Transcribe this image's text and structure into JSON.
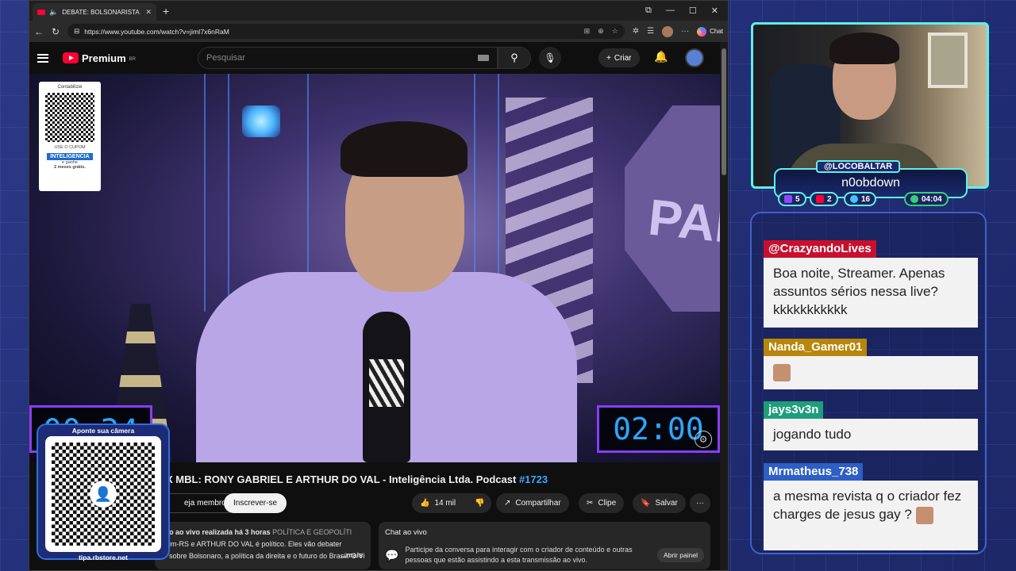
{
  "browser": {
    "tab_title": "DEBATE: BOLSONARISTA X M",
    "url": "https://www.youtube.com/watch?v=jimI7x6nRaM",
    "chat_label": "Chat"
  },
  "youtube": {
    "brand": "Premium",
    "region": "BR",
    "search_placeholder": "Pesquisar",
    "create_label": "Criar"
  },
  "video": {
    "qr_left_top": "Contabilizei",
    "qr_left_mid": "USE O CUPOM",
    "qr_left_tag": "INTELIGENCIA",
    "qr_left_line1": "e ganhe",
    "qr_left_line2": "2 meses grátis.",
    "stop_sign": "PAR",
    "timer_left": "00:34",
    "timer_right": "02:00"
  },
  "watch": {
    "title": "X MBL: RONY GABRIEL E ARTHUR DO VAL - Inteligência Ltda. Podcast",
    "title_hash": "#1723",
    "member_label": "eja membro",
    "subscribe_label": "Inscrever-se",
    "likes": "14 mil",
    "share_label": "Compartilhar",
    "clip_label": "Clipe",
    "save_label": "Salvar",
    "desc_line1": "o ao vivo realizada há 3 horas",
    "desc_category": "POLÍTICA E GEOPOLÍTI",
    "desc_line2": "im-RS e ARTHUR DO VAL é político. Eles vão debater",
    "desc_line3": "sobre Bolsonaro, a política da direita e o futuro do Brasil. O Vilela se preocupa muito",
    "desc_more": "...mais",
    "chat_title": "Chat ao vivo",
    "chat_text": "Participe da conversa para interagir com o criador de conteúdo e outras pessoas que estão assistindo a esta transmissão ao vivo.",
    "chat_open": "Abrir painel"
  },
  "qr_overlay": {
    "caption": "Aponte sua câmera",
    "footer": "tipa.rbstore.net"
  },
  "streamer": {
    "handle": "@LOCOBALTAR",
    "subtitle": "n0obdown",
    "badges": [
      {
        "value": "5",
        "color": "#9146ff"
      },
      {
        "value": "2",
        "color": "#ff0033"
      },
      {
        "value": "16",
        "color": "#3ec6ff"
      },
      {
        "value": "04:04",
        "color": "#34d07a"
      }
    ]
  },
  "chat": [
    {
      "user": "@CrazyandoLives",
      "color": "#c8102e",
      "text": "Boa noite, Streamer. Apenas assuntos sérios nessa live? kkkkkkkkkkk"
    },
    {
      "user": "Nanda_Gamer01",
      "color": "#b8860b",
      "text": ""
    },
    {
      "user": "jays3v3n",
      "color": "#1e9e7a",
      "text": "jogando tudo"
    },
    {
      "user": "Mrmatheus_738",
      "color": "#2d5fc4",
      "text": "a mesma revista q o criador fez charges de jesus gay ?"
    }
  ]
}
